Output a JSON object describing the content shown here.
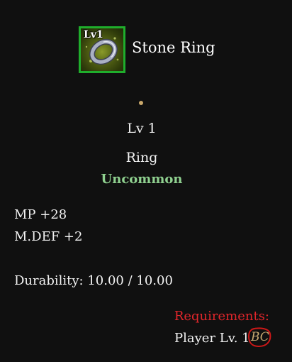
{
  "item": {
    "icon": "stone-ring-icon",
    "icon_level": "Lv1",
    "name": "Stone Ring",
    "level": "Lv 1",
    "type": "Ring",
    "grade": "Uncommon"
  },
  "stats": {
    "mp": "MP +28",
    "mdef": "M.DEF +2",
    "durability": "Durability: 10.00 / 10.00"
  },
  "requirements": {
    "title": "Requirements:",
    "player_level": "Player Lv. 1",
    "mark": "BC"
  },
  "colors": {
    "frame": "#1fae2c",
    "grade": "#8fd08f",
    "requirements": "#e0262b",
    "mark": "#c8a971",
    "annotation_circle": "#d01818"
  }
}
